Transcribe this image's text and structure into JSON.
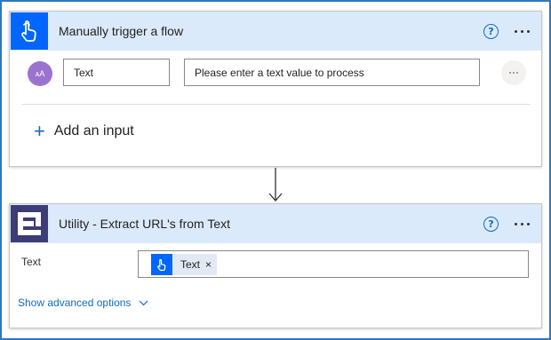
{
  "trigger": {
    "title": "Manually trigger a flow",
    "input": {
      "avatar_text": "ᴀA",
      "name": "Text",
      "description": "Please enter a text value to process"
    },
    "add_input_label": "Add an input"
  },
  "action": {
    "title": "Utility - Extract URL's from Text",
    "param_label": "Text",
    "token": {
      "label": "Text",
      "close": "×"
    },
    "advanced_label": "Show advanced options"
  },
  "icons": {
    "help": "?",
    "trigger_icon": "touch-hand-icon",
    "action_icon": "encodian-utility-icon"
  },
  "colors": {
    "header_bg": "#dbeafb",
    "trigger_icon_bg": "#0066ff",
    "action_icon_bg": "#3c3c78",
    "link": "#0f6cbd",
    "frame": "#2b78c2"
  }
}
